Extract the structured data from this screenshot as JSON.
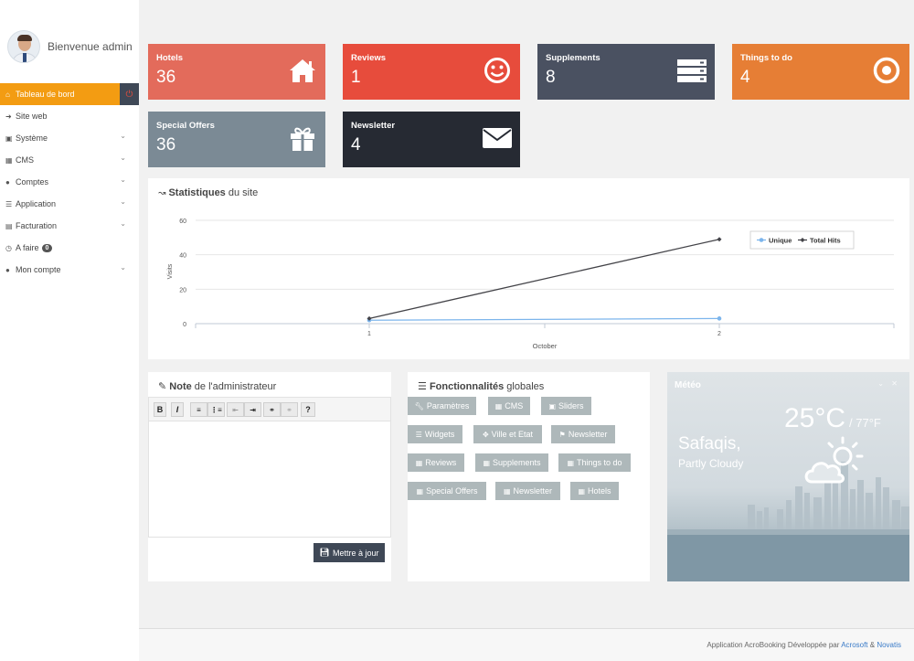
{
  "sidebar": {
    "welcome": "Bienvenue admin",
    "items": [
      {
        "label": "Tableau de bord",
        "icon": "home-icon"
      },
      {
        "label": "Site web",
        "icon": "sign-in-icon"
      },
      {
        "label": "Système",
        "icon": "laptop-icon"
      },
      {
        "label": "CMS",
        "icon": "table-icon"
      },
      {
        "label": "Comptes",
        "icon": "user-icon"
      },
      {
        "label": "Application",
        "icon": "list-icon"
      },
      {
        "label": "Facturation",
        "icon": "file-icon"
      },
      {
        "label": "A faire",
        "icon": "clock-icon",
        "badge": "0"
      },
      {
        "label": "Mon compte",
        "icon": "user-icon"
      }
    ]
  },
  "tiles": [
    {
      "title": "Hotels",
      "value": "36",
      "color": "#e36b5b",
      "icon": "home-icon"
    },
    {
      "title": "Reviews",
      "value": "1",
      "color": "#e74c3c",
      "icon": "smile-icon"
    },
    {
      "title": "Supplements",
      "value": "8",
      "color": "#4a5161",
      "icon": "server-icon"
    },
    {
      "title": "Things to do",
      "value": "4",
      "color": "#e67e35",
      "icon": "target-icon"
    },
    {
      "title": "Special Offers",
      "value": "36",
      "color": "#7b8a95",
      "icon": "gift-icon"
    },
    {
      "title": "Newsletter",
      "value": "4",
      "color": "#262a33",
      "icon": "envelope-icon"
    }
  ],
  "stats": {
    "title_bold": "Statistiques",
    "title_rest": " du site"
  },
  "chart_data": {
    "type": "line",
    "x": [
      1,
      2
    ],
    "categories": [
      "1",
      "2"
    ],
    "series": [
      {
        "name": "Unique",
        "values": [
          2,
          3
        ],
        "color": "#7cb5ec"
      },
      {
        "name": "Total Hits",
        "values": [
          3,
          49
        ],
        "color": "#434348"
      }
    ],
    "xlabel": "October",
    "ylabel": "Visits",
    "ylim": [
      0,
      60
    ],
    "yticks": [
      0,
      20,
      40,
      60
    ],
    "grid": true,
    "legend": "top-right"
  },
  "note": {
    "title_bold": "Note",
    "title_rest": " de l'administrateur",
    "toolbar": [
      "B",
      "I",
      "ol",
      "ul",
      "outdent",
      "indent",
      "link",
      "unlink",
      "?"
    ],
    "save_label": "Mettre à jour"
  },
  "features": {
    "title_bold": "Fonctionnalités",
    "title_rest": " globales",
    "buttons": [
      {
        "label": "Paramètres",
        "icon": "wrench-icon"
      },
      {
        "label": "CMS",
        "icon": "doc-icon"
      },
      {
        "label": "Sliders",
        "icon": "image-icon"
      },
      {
        "label": "Widgets",
        "icon": "list-icon"
      },
      {
        "label": "Ville et Etat",
        "icon": "crosshair-icon"
      },
      {
        "label": "Newsletter",
        "icon": "bookmark-icon"
      },
      {
        "label": "Reviews",
        "icon": "doc-icon"
      },
      {
        "label": "Supplements",
        "icon": "doc-icon"
      },
      {
        "label": "Things to do",
        "icon": "doc-icon"
      },
      {
        "label": "Special Offers",
        "icon": "doc-icon"
      },
      {
        "label": "Newsletter",
        "icon": "doc-icon"
      },
      {
        "label": "Hotels",
        "icon": "doc-icon"
      }
    ]
  },
  "weather": {
    "title": "Météo",
    "temp": "25°C",
    "alt_temp": "/ 77°F",
    "city": "Safaqis,",
    "condition": "Partly Cloudy",
    "icon": "partly-cloudy-icon"
  },
  "footer": {
    "text": "Application AcroBooking Développée par ",
    "link1": "Acrosoft",
    "amp": " & ",
    "link2": "Novatis"
  }
}
